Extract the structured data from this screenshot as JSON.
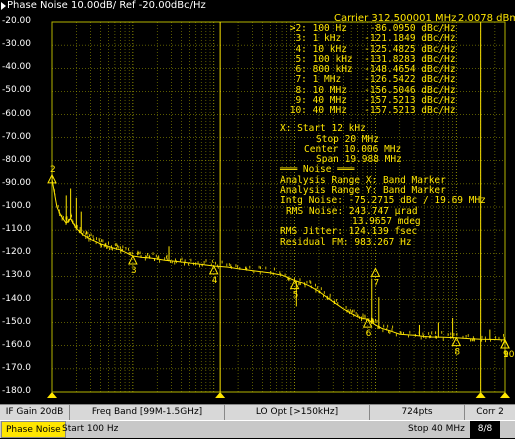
{
  "header": {
    "title": "Phase Noise 10.00dB/ Ref -20.00dBc/Hz",
    "carrier": "Carrier 312.500001 MHz",
    "carrier_level": "2.0078 dBm"
  },
  "marker_table": [
    {
      "id": ">2:",
      "freq": "100 Hz",
      "value": "-86.0950",
      "unit": "dBc/Hz"
    },
    {
      "id": "3:",
      "freq": "1 kHz",
      "value": "-121.1849",
      "unit": "dBc/Hz"
    },
    {
      "id": "4:",
      "freq": "10 kHz",
      "value": "-125.4825",
      "unit": "dBc/Hz"
    },
    {
      "id": "5:",
      "freq": "100 kHz",
      "value": "-131.8283",
      "unit": "dBc/Hz"
    },
    {
      "id": "6:",
      "freq": "800 kHz",
      "value": "-148.4654",
      "unit": "dBc/Hz"
    },
    {
      "id": "7:",
      "freq": "1 MHz",
      "value": "-126.5422",
      "unit": "dBc/Hz"
    },
    {
      "id": "8:",
      "freq": "10 MHz",
      "value": "-156.5046",
      "unit": "dBc/Hz"
    },
    {
      "id": "9:",
      "freq": "40 MHz",
      "value": "-157.5213",
      "unit": "dBc/Hz"
    },
    {
      "id": "10:",
      "freq": "40 MHz",
      "value": "-157.5213",
      "unit": "dBc/Hz"
    }
  ],
  "analysis": {
    "x_start": "X: Start 12 kHz",
    "x_stop": "Stop 20 MHz",
    "x_center": "Center 10.006 MHz",
    "x_span": "Span 19.988 MHz",
    "noise_header": "Noise",
    "range_x": "Analysis Range X: Band Marker",
    "range_y": "Analysis Range Y: Band Marker",
    "intg_noise": "Intg Noise: -75.2715 dBc / 19.69 MHz",
    "rms_noise_1": "RMS Noise: 243.747 µrad",
    "rms_noise_2": "13.9657 mdeg",
    "rms_jitter": "RMS Jitter: 124.139 fsec",
    "residual_fm": "Residual FM: 983.267 Hz"
  },
  "status_bar": {
    "if_gain": "IF Gain 20dB",
    "freq_band": "Freq Band [99M-1.5GHz]",
    "lo_opt": "LO Opt [>150kHz]",
    "points": "724pts",
    "corr": "Corr 2"
  },
  "bottom_bar": {
    "mode": "Phase Noise",
    "start": "Start 100 Hz",
    "stop": "Stop 40 MHz",
    "page": "8/8"
  },
  "colors": {
    "trace": "#ffe600",
    "grid": "#b4b400",
    "background": "#000000",
    "text": "#ffffff"
  },
  "chart_data": {
    "type": "line",
    "title": "Phase Noise 10.00dB/ Ref -20.00dBc/Hz",
    "xscale": "log",
    "xlim_hz": [
      100,
      40000000
    ],
    "ylim": [
      -180,
      -20
    ],
    "y_ticks": [
      "-20.00",
      "-30.00",
      "-40.00",
      "-50.00",
      "-60.00",
      "-70.00",
      "-80.00",
      "-90.00",
      "-100.0",
      "-110.0",
      "-120.0",
      "-130.0",
      "-140.0",
      "-150.0",
      "-160.0",
      "-170.0",
      "-180.0"
    ],
    "y_tick_values": [
      -20,
      -30,
      -40,
      -50,
      -60,
      -70,
      -80,
      -90,
      -100,
      -110,
      -120,
      -130,
      -140,
      -150,
      -160,
      -170,
      -180
    ],
    "series": [
      {
        "x_hz": [
          100,
          115,
          130,
          150,
          170,
          190,
          210,
          240,
          270,
          300,
          350,
          400,
          450,
          500,
          600,
          700,
          800,
          1000,
          1300,
          1600,
          2000,
          2500,
          3000,
          4000,
          5000,
          7000,
          10000,
          15000,
          20000,
          30000,
          50000,
          70000,
          100000,
          130000,
          160000,
          200000,
          250000,
          300000,
          400000,
          500000,
          600000,
          700000,
          800000,
          900000,
          1000000,
          1200000,
          1500000,
          2000000,
          3000000,
          4000000,
          5000000,
          7000000,
          10000000,
          15000000,
          20000000,
          30000000,
          40000000
        ],
        "values": [
          -88,
          -100,
          -104,
          -107,
          -105,
          -108,
          -110,
          -112,
          -113,
          -114,
          -115,
          -116,
          -116.5,
          -117,
          -118,
          -118.5,
          -119.5,
          -121.2,
          -121.8,
          -122,
          -122.5,
          -123,
          -123.3,
          -123.8,
          -124.2,
          -124.8,
          -125.5,
          -126,
          -126.7,
          -127.5,
          -128.5,
          -129.5,
          -131.8,
          -133,
          -134.5,
          -136.5,
          -139,
          -141,
          -144,
          -146,
          -147.5,
          -148.2,
          -148.5,
          -150,
          -151,
          -152.5,
          -153.5,
          -155,
          -155.5,
          -156,
          -156.2,
          -156.3,
          -156.5,
          -157,
          -157.2,
          -157.3,
          -157.5
        ]
      }
    ],
    "spurs_hz": [
      150,
      170,
      200,
      230,
      2800,
      105000,
      900000,
      1100000,
      3500000,
      6000000,
      9000000,
      26000000
    ],
    "spur_levels": [
      -95,
      -92,
      -96,
      -102,
      -117,
      -143,
      -131,
      -139,
      -151,
      -150,
      -148,
      -153
    ],
    "markers": [
      {
        "label": "2",
        "x_hz": 100,
        "y": -86.095
      },
      {
        "label": "3",
        "x_hz": 1000,
        "y": -121.1849
      },
      {
        "label": "4",
        "x_hz": 10000,
        "y": -125.4825
      },
      {
        "label": "5",
        "x_hz": 100000,
        "y": -131.8283
      },
      {
        "label": "6",
        "x_hz": 800000,
        "y": -148.4654
      },
      {
        "label": "7",
        "x_hz": 1000000,
        "y": -126.5422
      },
      {
        "label": "8",
        "x_hz": 10000000,
        "y": -156.5046
      },
      {
        "label": "9",
        "x_hz": 40000000,
        "y": -157.5213
      },
      {
        "label": "10",
        "x_hz": 40000000,
        "y": -157.5213
      }
    ],
    "band_markers_hz": [
      12000,
      20000000
    ]
  }
}
